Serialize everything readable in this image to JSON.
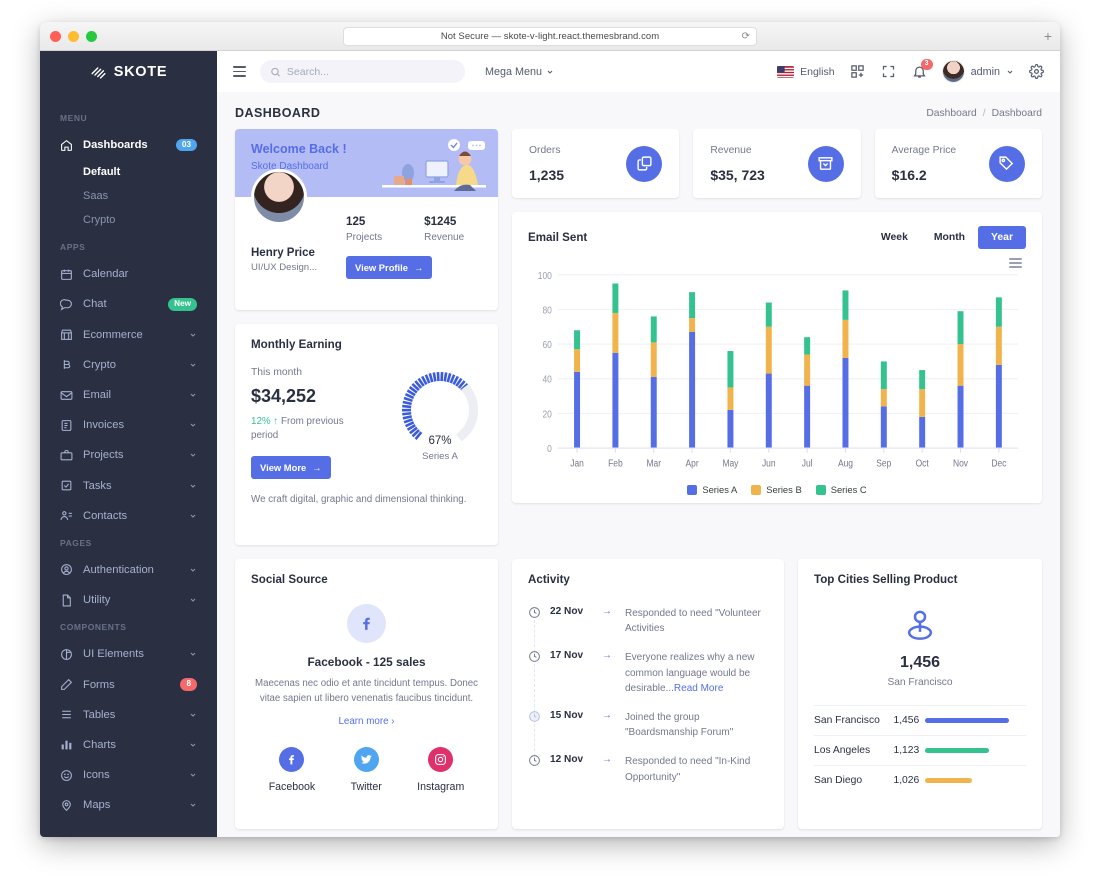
{
  "browser": {
    "url": "Not Secure — skote-v-light.react.themesbrand.com",
    "reload_icon": "reload-icon",
    "new_tab_label": "+"
  },
  "sidebar": {
    "brand": "SKOTE",
    "sections": [
      {
        "title": "MENU",
        "items": [
          {
            "label": "Dashboards",
            "icon": "home-icon",
            "badge": "03",
            "badge_type": "info",
            "active": true,
            "children": [
              {
                "label": "Default",
                "active": true
              },
              {
                "label": "Saas",
                "active": false
              },
              {
                "label": "Crypto",
                "active": false
              }
            ]
          }
        ]
      },
      {
        "title": "APPS",
        "items": [
          {
            "label": "Calendar",
            "icon": "calendar-icon"
          },
          {
            "label": "Chat",
            "icon": "chat-icon",
            "badge": "New",
            "badge_type": "success"
          },
          {
            "label": "Ecommerce",
            "icon": "store-icon",
            "chevron": true
          },
          {
            "label": "Crypto",
            "icon": "bitcoin-icon",
            "chevron": true
          },
          {
            "label": "Email",
            "icon": "mail-icon",
            "chevron": true
          },
          {
            "label": "Invoices",
            "icon": "invoice-icon",
            "chevron": true
          },
          {
            "label": "Projects",
            "icon": "briefcase-icon",
            "chevron": true
          },
          {
            "label": "Tasks",
            "icon": "task-icon",
            "chevron": true
          },
          {
            "label": "Contacts",
            "icon": "contacts-icon",
            "chevron": true
          }
        ]
      },
      {
        "title": "PAGES",
        "items": [
          {
            "label": "Authentication",
            "icon": "user-circle-icon",
            "chevron": true
          },
          {
            "label": "Utility",
            "icon": "file-icon",
            "chevron": true
          }
        ]
      },
      {
        "title": "COMPONENTS",
        "items": [
          {
            "label": "UI Elements",
            "icon": "ui-elements-icon",
            "chevron": true
          },
          {
            "label": "Forms",
            "icon": "pen-icon",
            "badge": "8",
            "badge_type": "danger"
          },
          {
            "label": "Tables",
            "icon": "table-icon",
            "chevron": true
          },
          {
            "label": "Charts",
            "icon": "bar-chart-icon",
            "chevron": true
          },
          {
            "label": "Icons",
            "icon": "smile-icon",
            "chevron": true
          },
          {
            "label": "Maps",
            "icon": "map-pin-icon",
            "chevron": true
          }
        ]
      }
    ]
  },
  "topbar": {
    "menu_toggle_icon": "hamburger-icon",
    "search_placeholder": "Search...",
    "search_value": "",
    "mega_menu": "Mega Menu",
    "language": "English",
    "apps_icon": "grid-apps-icon",
    "fullscreen_icon": "fullscreen-icon",
    "notification_icon": "bell-icon",
    "notification_count": "3",
    "user_name": "admin",
    "settings_icon": "gear-icon"
  },
  "page": {
    "title": "DASHBOARD",
    "breadcrumb": [
      "Dashboard",
      "Dashboard"
    ],
    "breadcrumb_sep": "/"
  },
  "welcome": {
    "title": "Welcome Back !",
    "subtitle": "Skote Dashboard",
    "name": "Henry Price",
    "role": "UI/UX Design...",
    "stats": [
      {
        "value": "125",
        "label": "Projects"
      },
      {
        "value": "$1245",
        "label": "Revenue"
      }
    ],
    "button": "View Profile",
    "button_arrow": "→"
  },
  "stat_cards": [
    {
      "label": "Orders",
      "value": "1,235",
      "icon": "copy-icon"
    },
    {
      "label": "Revenue",
      "value": "$35, 723",
      "icon": "archive-in-icon"
    },
    {
      "label": "Average Price",
      "value": "$16.2",
      "icon": "tag-icon"
    }
  ],
  "email_sent": {
    "title": "Email Sent",
    "range_options": [
      "Week",
      "Month",
      "Year"
    ],
    "selected_range": "Year",
    "menu_icon": "chart-menu-icon"
  },
  "chart_data": {
    "type": "bar",
    "stacked": true,
    "title": "Email Sent",
    "xlabel": "",
    "ylabel": "",
    "ylim": [
      0,
      100
    ],
    "yticks": [
      0,
      20,
      40,
      60,
      80,
      100
    ],
    "grid": true,
    "legend_position": "bottom",
    "categories": [
      "Jan",
      "Feb",
      "Mar",
      "Apr",
      "May",
      "Jun",
      "Jul",
      "Aug",
      "Sep",
      "Oct",
      "Nov",
      "Dec"
    ],
    "series": [
      {
        "name": "Series A",
        "color": "#556ee6",
        "values": [
          44,
          55,
          41,
          67,
          22,
          43,
          36,
          52,
          24,
          18,
          36,
          48
        ]
      },
      {
        "name": "Series B",
        "color": "#f1b44c",
        "values": [
          13,
          23,
          20,
          8,
          13,
          27,
          18,
          22,
          10,
          16,
          24,
          22
        ]
      },
      {
        "name": "Series C",
        "color": "#34c38f",
        "values": [
          11,
          17,
          15,
          15,
          21,
          14,
          10,
          17,
          16,
          11,
          19,
          17
        ]
      }
    ],
    "totals": [
      68,
      95,
      76,
      90,
      56,
      84,
      64,
      91,
      50,
      45,
      79,
      87
    ]
  },
  "monthly_earning": {
    "title": "Monthly Earning",
    "subtitle": "This month",
    "amount": "$34,252",
    "delta": "12%",
    "delta_arrow": "↑",
    "delta_text": "From previous period",
    "button": "View More",
    "button_arrow": "→",
    "note": "We craft digital, graphic and dimensional thinking.",
    "radial_percent": "67%",
    "radial_value": 67,
    "radial_label": "Series A"
  },
  "social_source": {
    "title": "Social Source",
    "featured_icon": "facebook-icon",
    "heading": "Facebook - 125 sales",
    "description": "Maecenas nec odio et ante tincidunt tempus. Donec vitae sapien ut libero venenatis faucibus tincidunt.",
    "learn_more": "Learn more",
    "learn_more_arrow": "›",
    "networks": [
      {
        "name": "Facebook",
        "icon": "facebook-icon",
        "color": "#556ee6"
      },
      {
        "name": "Twitter",
        "icon": "twitter-icon",
        "color": "#50a5f1"
      },
      {
        "name": "Instagram",
        "icon": "instagram-icon",
        "color": "#e0306b"
      }
    ]
  },
  "activity": {
    "title": "Activity",
    "items": [
      {
        "date": "22 Nov",
        "arrow": "→",
        "text": "Responded to need \"Volunteer Activities",
        "link": ""
      },
      {
        "date": "17 Nov",
        "arrow": "→",
        "text": "Everyone realizes why a new common language would be desirable...",
        "link": "Read More"
      },
      {
        "date": "15 Nov",
        "arrow": "→",
        "text": "Joined the group \"Boardsmanship Forum\"",
        "link": ""
      },
      {
        "date": "12 Nov",
        "arrow": "→",
        "text": "Responded to need \"In-Kind Opportunity\"",
        "link": ""
      }
    ]
  },
  "top_cities": {
    "title": "Top Cities Selling Product",
    "pin_icon": "location-pin-icon",
    "featured_value": "1,456",
    "featured_label": "San Francisco",
    "rows": [
      {
        "city": "San Francisco",
        "value": "1,456",
        "bar_percent": 100,
        "color": "#556ee6"
      },
      {
        "city": "Los Angeles",
        "value": "1,123",
        "bar_percent": 77,
        "color": "#34c38f"
      },
      {
        "city": "San Diego",
        "value": "1,026",
        "bar_percent": 57,
        "color": "#f1b44c"
      }
    ]
  }
}
